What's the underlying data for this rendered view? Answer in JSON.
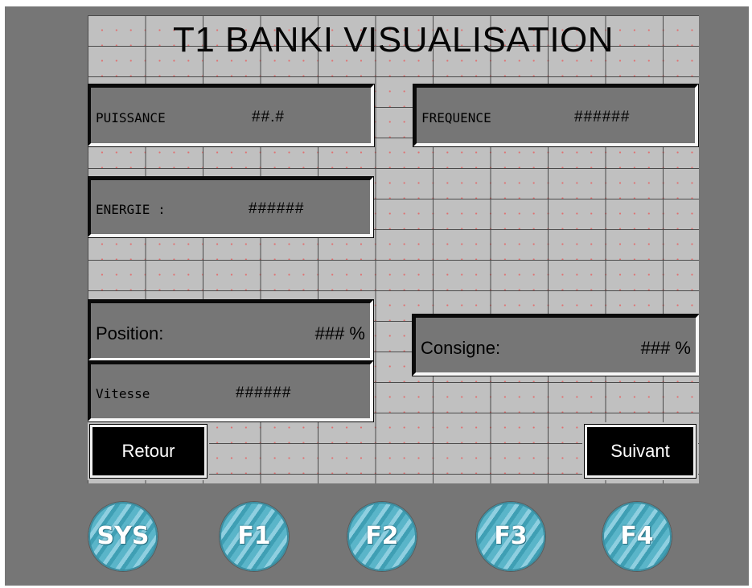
{
  "title": "T1  BANKI VISUALISATION",
  "fields": {
    "puissance": {
      "label": "PUISSANCE",
      "value": "##.#"
    },
    "frequence": {
      "label": "FREQUENCE",
      "value": "######"
    },
    "energie": {
      "label": "ENERGIE :",
      "value": "######"
    },
    "position": {
      "label": "Position:",
      "value": "### %"
    },
    "consigne": {
      "label": "Consigne:",
      "value": "### %"
    },
    "vitesse": {
      "label": "Vitesse",
      "value": "######"
    }
  },
  "buttons": {
    "retour": "Retour",
    "suivant": "Suivant"
  },
  "function_keys": [
    "SYS",
    "F1",
    "F2",
    "F3",
    "F4"
  ],
  "colors": {
    "bezel": "#767676",
    "screen": "#c0c0c0",
    "field": "#767676",
    "button": "#000000",
    "key": "#5ab5c9"
  }
}
